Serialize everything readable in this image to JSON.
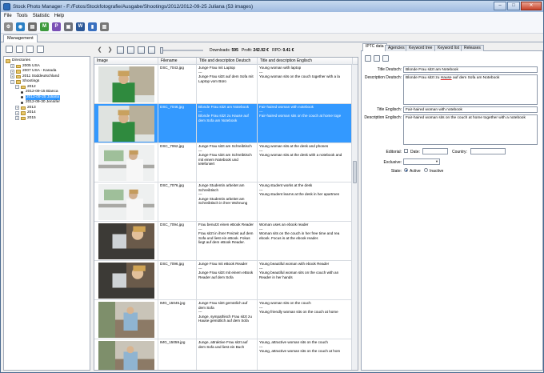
{
  "window": {
    "title": "Stock Photo Manager - F:/Fotos/Stockfotografie/Ausgabe/Shootings/2012/2012-09-25 Juliana (53 images)",
    "minimize": "–",
    "maximize": "□",
    "close": "✕"
  },
  "menu": {
    "items": [
      "File",
      "Tools",
      "Statistic",
      "Help"
    ]
  },
  "main_toolbar": {
    "icons": [
      {
        "name": "settings-icon",
        "symbol": "⚙",
        "color": "#8a8a8a"
      },
      {
        "name": "globe-icon",
        "symbol": "◉",
        "color": "#2a7fc4"
      },
      {
        "name": "sqlite-icon",
        "symbol": "▤",
        "color": "#6d6d6d"
      },
      {
        "name": "module-m-icon",
        "symbol": "M",
        "color": "#3d9a3d"
      },
      {
        "name": "module-p-icon",
        "symbol": "P",
        "color": "#7a4fb5"
      },
      {
        "name": "print-icon",
        "symbol": "▣",
        "color": "#6d7078"
      },
      {
        "name": "word-icon",
        "symbol": "W",
        "color": "#2b5797"
      },
      {
        "name": "chart-icon",
        "symbol": "▮",
        "color": "#3970c0"
      },
      {
        "name": "stats-icon",
        "symbol": "▥",
        "color": "#777"
      }
    ]
  },
  "main_tabs": [
    {
      "label": "Management"
    }
  ],
  "tree": {
    "rows": [
      {
        "indent": 0,
        "exp": "",
        "kind": "folder",
        "label": "Directories"
      },
      {
        "indent": 1,
        "exp": "+",
        "kind": "folder",
        "label": "2005 USA"
      },
      {
        "indent": 1,
        "exp": "+",
        "kind": "folder",
        "label": "2007 USA - Kanada"
      },
      {
        "indent": 1,
        "exp": "+",
        "kind": "folder",
        "label": "2011 Süddeutschland"
      },
      {
        "indent": 1,
        "exp": "−",
        "kind": "folder",
        "label": "Shootings"
      },
      {
        "indent": 2,
        "exp": "−",
        "kind": "folder",
        "label": "2012"
      },
      {
        "indent": 3,
        "exp": "",
        "kind": "bullet",
        "label": "2012-09-15 Bianca"
      },
      {
        "indent": 3,
        "exp": "",
        "kind": "bullet",
        "label": "2012-09-25 Juliana",
        "selected": true
      },
      {
        "indent": 3,
        "exp": "",
        "kind": "bullet",
        "label": "2012-09-30 Jennifer"
      },
      {
        "indent": 2,
        "exp": "+",
        "kind": "folder",
        "label": "2013"
      },
      {
        "indent": 2,
        "exp": "+",
        "kind": "folder",
        "label": "2014"
      },
      {
        "indent": 2,
        "exp": "+",
        "kind": "folder",
        "label": "2015"
      }
    ]
  },
  "center_toolbar": {
    "nav_back": "❮",
    "nav_forward": "❯",
    "stats": {
      "downloads_label": "Downloads:",
      "downloads": "595",
      "profit_label": "Profit:",
      "profit": "242.92 €",
      "rpd_label": "RPD:",
      "rpd": "0.41 €"
    }
  },
  "grid": {
    "columns": [
      "Image",
      "Filename",
      "Title and description Deutsch",
      "Title and description Englisch"
    ],
    "rows": [
      {
        "file": "DSC_7043.jpg",
        "de": "Junge Frau mit Laptop\n---\nJunge Frau sitzt auf dem Sofa mit Laptop vom Büro",
        "en": "Young woman with laptop\n---\nYoung woman sits on the couch together with a la",
        "selected": false,
        "thumb": "green"
      },
      {
        "file": "DSC_7046.jpg",
        "de": "Blonde Frau sitzt am Notebook\n---\nBlonde Frau sitzt zu Hause auf dem Sofa am Notebook",
        "en": "Fair-haired woman with notebook\n---\nFair-haired woman sits on the couch at home toge",
        "selected": true,
        "thumb": "green"
      },
      {
        "file": "DSC_7062.jpg",
        "de": "Junge Frau sitzt am Schreibtisch\n---\nJunge Frau sitzt am Schreibtisch mit einem Notebook und telefoniert",
        "en": "Young woman sits at the desk and phones\n---\nYoung woman sits at the desk with a notebook and",
        "selected": false,
        "thumb": "white"
      },
      {
        "file": "DSC_7076.jpg",
        "de": "Junge Studentin arbeitet am Schreibtisch\n---\nJunge Studentin arbeitet am Schreibtisch in ihrer Wohnung",
        "en": "Young student works at the desk\n---\nYoung student learns at the desk in her apartmen",
        "selected": false,
        "thumb": "white"
      },
      {
        "file": "DSC_7094.jpg",
        "de": "Frau benutzt einen eBook Reader\n---\nFrau sitzt in ihrer Freizeit auf dem Sofa und liest ein eBook. Fokus liegt auf dem eBook Reader.",
        "en": "Woman uses an ebook reader\n---\nWoman sits on the couch in her free time and rea ebook. Focus is at the ebook reader.",
        "selected": false,
        "thumb": "dark"
      },
      {
        "file": "DSC_7096.jpg",
        "de": "Junge Frau mit eBook Reader\n---\nJunge Frau sitzt mit einem eBook Reader auf dem Sofa",
        "en": "Young beautiful woman with ebook Reader\n---\nYoung beautiful woman sits on the couch with an Reader in her hands",
        "selected": false,
        "thumb": "dark"
      },
      {
        "file": "IMG_15045.jpg",
        "de": "Junge Frau sitzt gemütlich auf dem Sofa\n---\nJunge, sympathisch Frau sitzt zu Hause gemütlich auf dem Sofa",
        "en": "Young woman sits on the couch\n---\nYoung friendly woman sits on the couch at home",
        "selected": false,
        "thumb": "living"
      },
      {
        "file": "IMG_15059.jpg",
        "de": "Junge, attraktive Frau sitzt auf dem Sofa und liest ein Buch",
        "en": "Young, attractive woman sits on the couch\n---\nYoung, attractive woman sits on the couch at hom",
        "selected": false,
        "thumb": "living"
      }
    ]
  },
  "right": {
    "tabs": [
      "IPTC data",
      "Agencies",
      "Keyword tree",
      "Keyword list",
      "Releases"
    ],
    "title_de_label": "Title Deutsch:",
    "title_de": "Blonde Frau sitzt am Notebook",
    "desc_de_label": "Description Deutsch:",
    "desc_de_pre": "Blonde Frau sitzt zu ",
    "desc_de_underlined": "Hause",
    "desc_de_post": " auf dem Sofa am Notebook",
    "title_en_label": "Title Englisch:",
    "title_en": "Fair-haired woman with notebook",
    "desc_en_label": "Description Englisch:",
    "desc_en": "Fair-haired woman sits on the couch at home together with a notebook",
    "editorial_label": "Editorial:",
    "date_label": "Date:",
    "country_label": "Country:",
    "exclusive_label": "Exclusive:",
    "state_label": "State:",
    "state_active": "Active",
    "state_inactive": "Inactive"
  }
}
